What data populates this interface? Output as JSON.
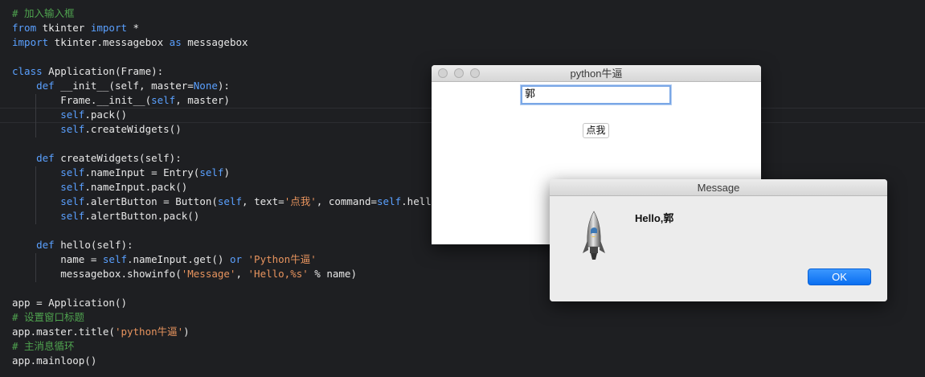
{
  "editor": {
    "lines": [
      [
        {
          "t": "cm",
          "v": "# 加入输入框"
        }
      ],
      [
        {
          "t": "kw",
          "v": "from"
        },
        {
          "t": "id",
          "v": " tkinter "
        },
        {
          "t": "kw",
          "v": "import"
        },
        {
          "t": "id",
          "v": " *"
        }
      ],
      [
        {
          "t": "kw",
          "v": "import"
        },
        {
          "t": "id",
          "v": " tkinter.messagebox "
        },
        {
          "t": "kw",
          "v": "as"
        },
        {
          "t": "id",
          "v": " messagebox"
        }
      ],
      [],
      [
        {
          "t": "kw",
          "v": "class"
        },
        {
          "t": "id",
          "v": " Application(Frame):"
        }
      ],
      [
        {
          "t": "id",
          "v": "    "
        },
        {
          "t": "kw",
          "v": "def"
        },
        {
          "t": "id",
          "v": " __init__(self, master="
        },
        {
          "t": "kw",
          "v": "None"
        },
        {
          "t": "id",
          "v": "):"
        }
      ],
      [
        {
          "t": "id",
          "v": "        Frame.__init__("
        },
        {
          "t": "kw",
          "v": "self"
        },
        {
          "t": "id",
          "v": ", master)"
        }
      ],
      [
        {
          "t": "id",
          "v": "        "
        },
        {
          "t": "kw",
          "v": "self"
        },
        {
          "t": "id",
          "v": ".pack()"
        }
      ],
      [
        {
          "t": "id",
          "v": "        "
        },
        {
          "t": "kw",
          "v": "self"
        },
        {
          "t": "id",
          "v": ".createWidgets()"
        }
      ],
      [],
      [
        {
          "t": "id",
          "v": "    "
        },
        {
          "t": "kw",
          "v": "def"
        },
        {
          "t": "id",
          "v": " createWidgets(self):"
        }
      ],
      [
        {
          "t": "id",
          "v": "        "
        },
        {
          "t": "kw",
          "v": "self"
        },
        {
          "t": "id",
          "v": ".nameInput = Entry("
        },
        {
          "t": "kw",
          "v": "self"
        },
        {
          "t": "id",
          "v": ")"
        }
      ],
      [
        {
          "t": "id",
          "v": "        "
        },
        {
          "t": "kw",
          "v": "self"
        },
        {
          "t": "id",
          "v": ".nameInput.pack()"
        }
      ],
      [
        {
          "t": "id",
          "v": "        "
        },
        {
          "t": "kw",
          "v": "self"
        },
        {
          "t": "id",
          "v": ".alertButton = Button("
        },
        {
          "t": "kw",
          "v": "self"
        },
        {
          "t": "id",
          "v": ", text="
        },
        {
          "t": "str",
          "v": "'点我'"
        },
        {
          "t": "id",
          "v": ", command="
        },
        {
          "t": "kw",
          "v": "self"
        },
        {
          "t": "id",
          "v": ".hello)"
        }
      ],
      [
        {
          "t": "id",
          "v": "        "
        },
        {
          "t": "kw",
          "v": "self"
        },
        {
          "t": "id",
          "v": ".alertButton.pack()"
        }
      ],
      [],
      [
        {
          "t": "id",
          "v": "    "
        },
        {
          "t": "kw",
          "v": "def"
        },
        {
          "t": "id",
          "v": " hello(self):"
        }
      ],
      [
        {
          "t": "id",
          "v": "        name = "
        },
        {
          "t": "kw",
          "v": "self"
        },
        {
          "t": "id",
          "v": ".nameInput.get() "
        },
        {
          "t": "kw",
          "v": "or"
        },
        {
          "t": "id",
          "v": " "
        },
        {
          "t": "str",
          "v": "'Python牛逼'"
        }
      ],
      [
        {
          "t": "id",
          "v": "        messagebox.showinfo("
        },
        {
          "t": "str",
          "v": "'Message'"
        },
        {
          "t": "id",
          "v": ", "
        },
        {
          "t": "str",
          "v": "'Hello,%s'"
        },
        {
          "t": "id",
          "v": " % name)"
        }
      ],
      [],
      [
        {
          "t": "id",
          "v": "app = Application()"
        }
      ],
      [
        {
          "t": "cm",
          "v": "# 设置窗口标题"
        }
      ],
      [
        {
          "t": "id",
          "v": "app.master.title("
        },
        {
          "t": "str",
          "v": "'python牛逼'"
        },
        {
          "t": "id",
          "v": ")"
        }
      ],
      [
        {
          "t": "cm",
          "v": "# 主消息循环"
        }
      ],
      [
        {
          "t": "id",
          "v": "app.mainloop()"
        }
      ]
    ]
  },
  "app_window": {
    "title": "python牛逼",
    "entry_value": "郭",
    "button_label": "点我"
  },
  "message_window": {
    "title": "Message",
    "message": "Hello,郭",
    "ok_label": "OK",
    "icon": "python-rocket-icon"
  },
  "colors": {
    "keyword": "#5aa0ff",
    "string": "#e8945e",
    "comment": "#4fa34f",
    "ok_button": "#0a6ef0"
  }
}
